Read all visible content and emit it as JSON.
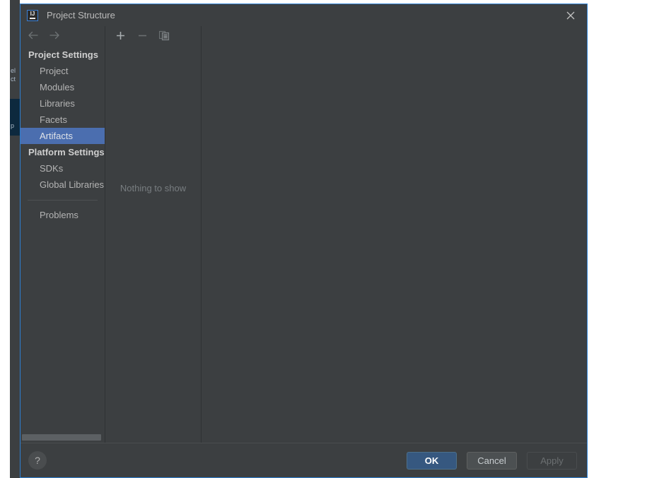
{
  "window": {
    "title": "Project Structure",
    "app_icon": "intellij-idea-icon",
    "icon_text": "IJ",
    "close_label": "×",
    "border_color": "#2d7fd0",
    "background": "#3c3f41"
  },
  "navigation": {
    "back_icon": "arrow-left-icon",
    "forward_icon": "arrow-right-icon",
    "back_enabled": false,
    "forward_enabled": false
  },
  "sidebar": {
    "groups": [
      {
        "label": "Project Settings",
        "items": [
          {
            "label": "Project",
            "selected": false
          },
          {
            "label": "Modules",
            "selected": false
          },
          {
            "label": "Libraries",
            "selected": false
          },
          {
            "label": "Facets",
            "selected": false
          },
          {
            "label": "Artifacts",
            "selected": true
          }
        ]
      },
      {
        "label": "Platform Settings",
        "items": [
          {
            "label": "SDKs",
            "selected": false
          },
          {
            "label": "Global Libraries",
            "selected": false
          }
        ]
      }
    ],
    "extra_items": [
      {
        "label": "Problems",
        "selected": false
      }
    ],
    "selection_color": "#4b6eaf",
    "scrollbar_visible": true
  },
  "list_panel": {
    "toolbar": [
      {
        "name": "add-artifact-button",
        "icon": "plus-icon",
        "label": "+",
        "enabled": true
      },
      {
        "name": "remove-artifact-button",
        "icon": "minus-icon",
        "label": "−",
        "enabled": false
      },
      {
        "name": "copy-artifact-button",
        "icon": "copy-icon",
        "label": "Copy",
        "enabled": false
      }
    ],
    "empty_message": "Nothing to show"
  },
  "detail_panel": {
    "content": ""
  },
  "footer": {
    "help_label": "?",
    "buttons": [
      {
        "name": "ok-button",
        "label": "OK",
        "style": "default",
        "enabled": true
      },
      {
        "name": "cancel-button",
        "label": "Cancel",
        "style": "normal",
        "enabled": true
      },
      {
        "name": "apply-button",
        "label": "Apply",
        "style": "disabled",
        "enabled": false
      }
    ]
  }
}
